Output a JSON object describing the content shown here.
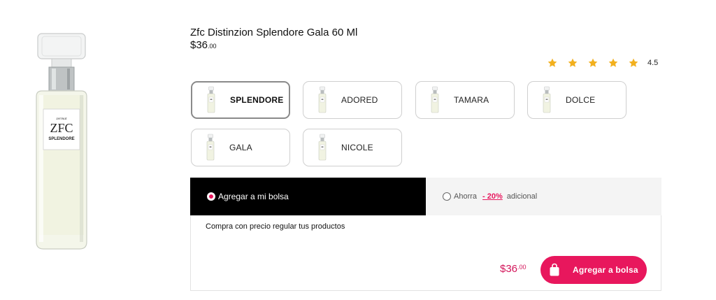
{
  "product": {
    "title": "Zfc Distinzion Splendore Gala 60 Ml",
    "price_main": "$36",
    "price_cents": ".00",
    "label_brand": "zermat",
    "label_logo": "ZFC",
    "label_name": "SPLENDORE"
  },
  "rating": {
    "value": "4.5",
    "stars": 5,
    "star_color": "#f2b01e"
  },
  "variants": [
    {
      "label": "SPLENDORE",
      "selected": true
    },
    {
      "label": "ADORED",
      "selected": false
    },
    {
      "label": "TAMARA",
      "selected": false
    },
    {
      "label": "DOLCE",
      "selected": false
    },
    {
      "label": "GALA",
      "selected": false
    },
    {
      "label": "NICOLE",
      "selected": false
    }
  ],
  "purchase": {
    "add_option_label": "Agregar a mi bolsa",
    "save_option_prefix": "Ahorra",
    "save_option_discount": "- 20%",
    "save_option_suffix": "adicional",
    "note": "Compra con precio regular tus productos",
    "total_main": "$36",
    "total_cents": ".00",
    "button_label": "Agregar a bolsa",
    "accent_color": "#e8175d"
  }
}
